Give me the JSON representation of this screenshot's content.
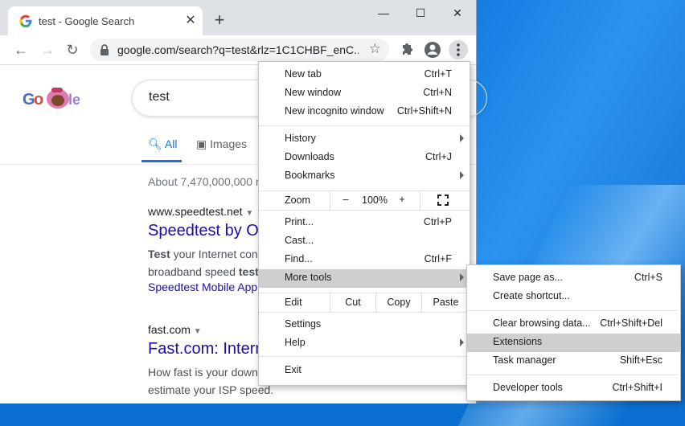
{
  "tab": {
    "title": "test - Google Search",
    "close": "✕"
  },
  "window": {
    "new_tab": "+",
    "minimize": "—",
    "maximize": "☐",
    "close": "✕"
  },
  "omnibox": {
    "url": "google.com/search?q=test&rlz=1C1CHBF_enC..."
  },
  "page": {
    "query": "test",
    "tabs": {
      "all": "All",
      "images": "Images"
    },
    "stats": "About 7,470,000,000 r",
    "results": [
      {
        "cite": "www.speedtest.net",
        "title": "Speedtest by O",
        "snippet1_bold": "Test",
        "snippet1": " your Internet con",
        "snippet2": "broadband speed ",
        "snippet2_bold": "test",
        "sitelink": "Speedtest Mobile App"
      },
      {
        "cite": "fast.com",
        "title": "Fast.com: Intern",
        "snippet1": "How fast is your down",
        "snippet2": "estimate your ISP speed."
      }
    ]
  },
  "menu": {
    "new_tab": {
      "label": "New tab",
      "shortcut": "Ctrl+T"
    },
    "new_window": {
      "label": "New window",
      "shortcut": "Ctrl+N"
    },
    "incognito": {
      "label": "New incognito window",
      "shortcut": "Ctrl+Shift+N"
    },
    "history": {
      "label": "History"
    },
    "downloads": {
      "label": "Downloads",
      "shortcut": "Ctrl+J"
    },
    "bookmarks": {
      "label": "Bookmarks"
    },
    "zoom": {
      "label": "Zoom",
      "minus": "–",
      "value": "100%",
      "plus": "+"
    },
    "print": {
      "label": "Print...",
      "shortcut": "Ctrl+P"
    },
    "cast": {
      "label": "Cast..."
    },
    "find": {
      "label": "Find...",
      "shortcut": "Ctrl+F"
    },
    "more_tools": {
      "label": "More tools"
    },
    "edit": {
      "label": "Edit",
      "cut": "Cut",
      "copy": "Copy",
      "paste": "Paste"
    },
    "settings": {
      "label": "Settings"
    },
    "help": {
      "label": "Help"
    },
    "exit": {
      "label": "Exit"
    }
  },
  "submenu": {
    "save_page": {
      "label": "Save page as...",
      "shortcut": "Ctrl+S"
    },
    "create_shortcut": {
      "label": "Create shortcut..."
    },
    "clear_data": {
      "label": "Clear browsing data...",
      "shortcut": "Ctrl+Shift+Del"
    },
    "extensions": {
      "label": "Extensions"
    },
    "task_manager": {
      "label": "Task manager",
      "shortcut": "Shift+Esc"
    },
    "dev_tools": {
      "label": "Developer tools",
      "shortcut": "Ctrl+Shift+I"
    }
  }
}
